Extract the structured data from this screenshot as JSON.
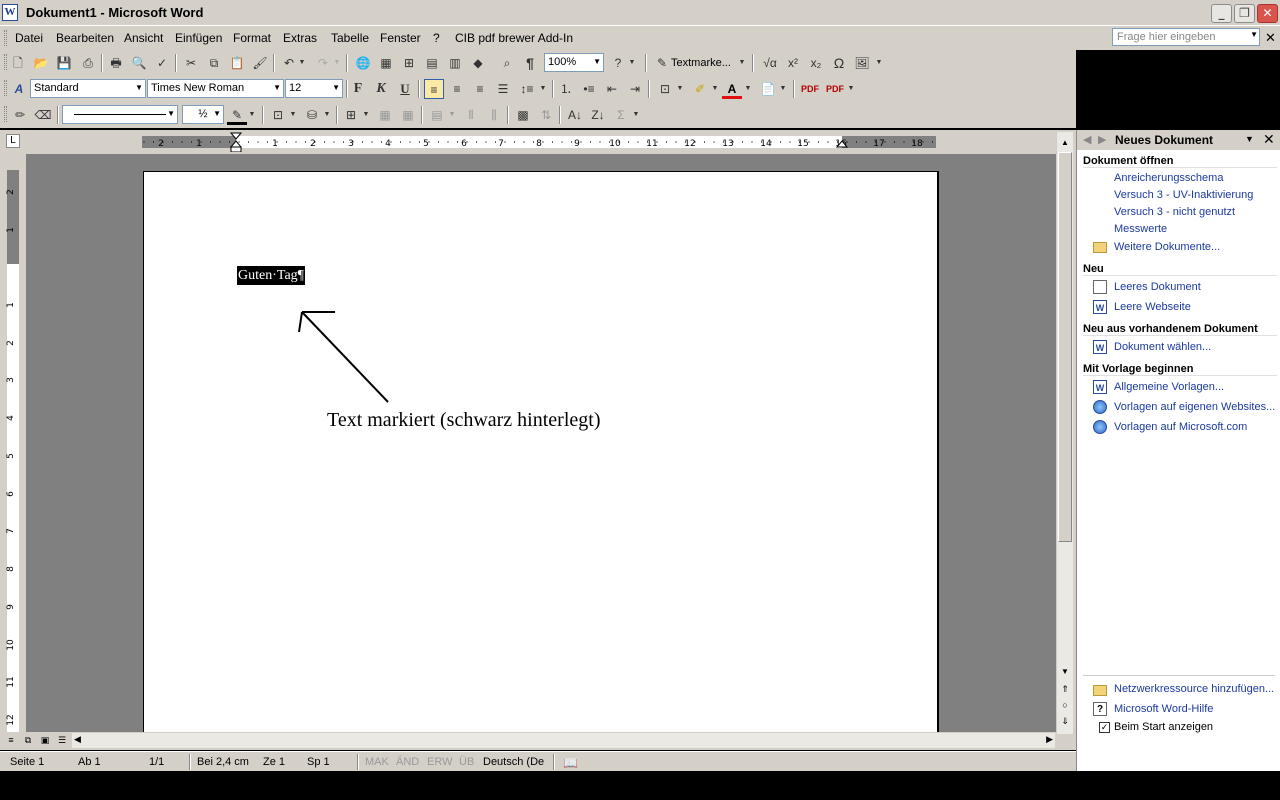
{
  "window": {
    "title": "Dokument1 - Microsoft Word",
    "app_icon": "W"
  },
  "menu": {
    "items": [
      "Datei",
      "Bearbeiten",
      "Ansicht",
      "Einfügen",
      "Format",
      "Extras",
      "Tabelle",
      "Fenster",
      "?",
      "CIB pdf brewer Add-In"
    ],
    "help_placeholder": "Frage hier eingeben"
  },
  "toolbar_standard": {
    "zoom": "100%",
    "textmarker_label": "Textmarke..."
  },
  "toolbar_format": {
    "style": "Standard",
    "font": "Times New Roman",
    "size": "12",
    "bold_label": "F",
    "italic_label": "K",
    "underline_label": "U"
  },
  "toolbar_drawing": {
    "line_weight": "½"
  },
  "ruler": {
    "h_labels": [
      "2",
      "1",
      "1",
      "2",
      "3",
      "4",
      "5",
      "6",
      "7",
      "8",
      "9",
      "10",
      "11",
      "12",
      "13",
      "14",
      "15",
      "16",
      "17",
      "18"
    ],
    "v_labels": [
      "2",
      "1",
      "1",
      "2",
      "3",
      "4",
      "5",
      "6",
      "7",
      "8",
      "9",
      "10",
      "11",
      "12"
    ]
  },
  "document": {
    "selected_text": "Guten·Tag¶",
    "annotation": "Text markiert (schwarz hinterlegt)"
  },
  "status": {
    "page": "Seite 1",
    "section": "Ab 1",
    "pages": "1/1",
    "at": "Bei 2,4 cm",
    "line": "Ze 1",
    "col": "Sp 1",
    "mak": "MAK",
    "and": "ÄND",
    "erw": "ERW",
    "ub": "ÜB",
    "lang": "Deutsch (De"
  },
  "taskpane": {
    "title": "Neues Dokument",
    "open_header": "Dokument öffnen",
    "recent": [
      "Anreicherungsschema",
      "Versuch 3 - UV-Inaktivierung",
      "Versuch 3 - nicht genutzt",
      "Messwerte"
    ],
    "more_docs": "Weitere Dokumente...",
    "new_header": "Neu",
    "blank_doc": "Leeres Dokument",
    "blank_web": "Leere Webseite",
    "from_existing_header": "Neu aus vorhandenem Dokument",
    "choose_doc": "Dokument wählen...",
    "template_header": "Mit Vorlage beginnen",
    "general_templates": "Allgemeine Vorlagen...",
    "website_templates": "Vorlagen auf eigenen Websites...",
    "ms_templates": "Vorlagen auf Microsoft.com",
    "add_network": "Netzwerkressource hinzufügen...",
    "word_help": "Microsoft Word-Hilfe",
    "show_on_start": "Beim Start anzeigen",
    "show_on_start_checked": true
  }
}
